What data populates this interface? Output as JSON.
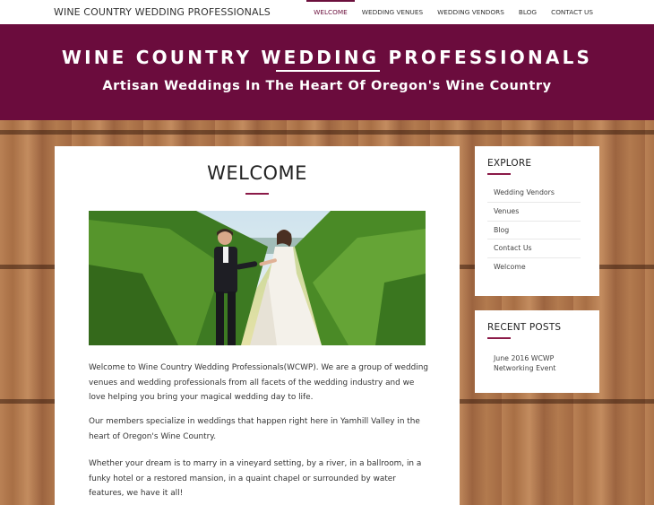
{
  "header": {
    "site_name": "WINE COUNTRY WEDDING PROFESSIONALS",
    "nav": [
      {
        "label": "WELCOME",
        "active": true
      },
      {
        "label": "WEDDING VENUES",
        "active": false
      },
      {
        "label": "WEDDING VENDORS",
        "active": false
      },
      {
        "label": "BLOG",
        "active": false
      },
      {
        "label": "CONTACT US",
        "active": false
      }
    ]
  },
  "banner": {
    "title": "WINE COUNTRY WEDDING PROFESSIONALS",
    "subtitle": "Artisan Weddings In The Heart Of Oregon's Wine Country",
    "background": "#6b0c3d"
  },
  "main": {
    "title": "WELCOME",
    "paragraphs": [
      "Welcome to Wine Country Wedding Professionals(WCWP). We are a group of wedding venues and wedding professionals from all facets of the wedding industry and we love helping you bring your magical wedding day to life.",
      "Our members specialize in weddings that happen right here in Yamhill Valley in the heart of Oregon's Wine Country.",
      "Whether your dream is to marry in a vineyard setting, by a river, in a ballroom, in a funky hotel or a restored mansion, in a quaint chapel or surrounded by water features, we have it all!"
    ]
  },
  "sidebar": {
    "explore": {
      "title": "EXPLORE",
      "items": [
        "Wedding Vendors",
        "Venues",
        "Blog",
        "Contact Us",
        "Welcome"
      ]
    },
    "recent": {
      "title": "RECENT POSTS",
      "items": [
        "June 2016 WCWP Networking Event"
      ]
    }
  },
  "colors": {
    "accent": "#6b0f3c",
    "rule": "#8b1a48",
    "wood": "#b27a4e"
  },
  "icons": []
}
